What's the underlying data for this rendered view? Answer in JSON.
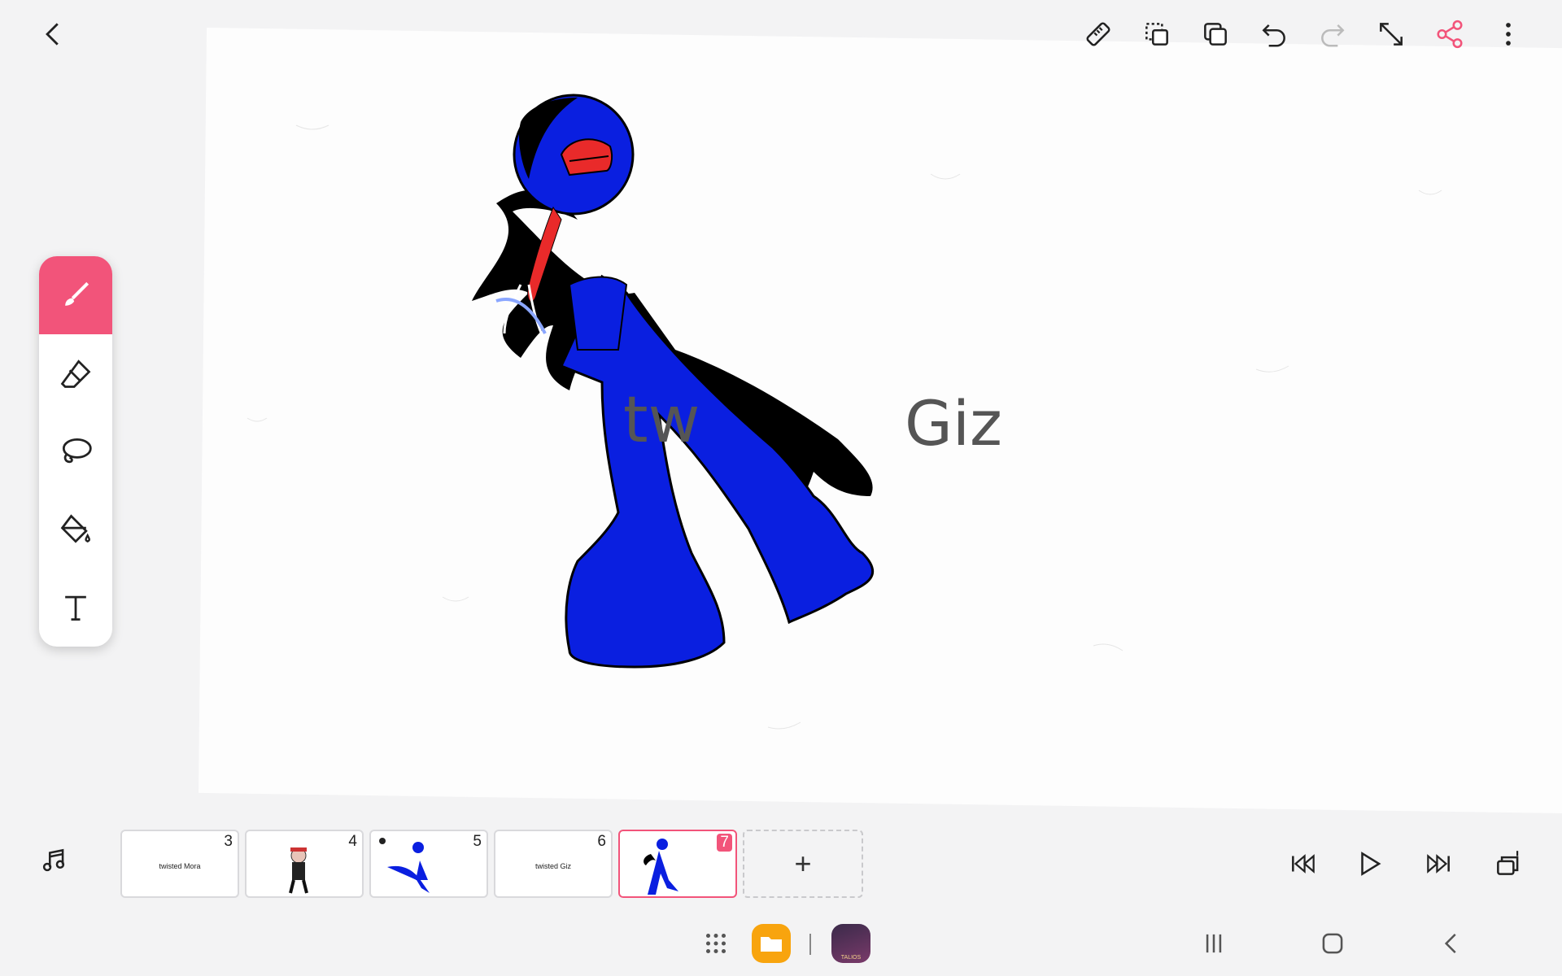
{
  "toolbar": {
    "back": "back-icon",
    "actions": [
      "ruler-icon",
      "duplicate-frame-icon",
      "copy-icon",
      "undo-icon",
      "redo-icon",
      "resize-icon",
      "share-icon",
      "more-icon"
    ],
    "accent_color": "#f2547a"
  },
  "canvas": {
    "watermark_left": "tw",
    "watermark_right": "Giz"
  },
  "tools": [
    {
      "name": "brush",
      "icon": "brush-icon",
      "active": true
    },
    {
      "name": "eraser",
      "icon": "eraser-icon",
      "active": false
    },
    {
      "name": "lasso",
      "icon": "lasso-icon",
      "active": false
    },
    {
      "name": "fill",
      "icon": "paint-bucket-icon",
      "active": false
    },
    {
      "name": "text",
      "icon": "text-icon",
      "active": false
    }
  ],
  "timeline": {
    "music_icon": "music-icon",
    "frames": [
      {
        "number": "3",
        "caption": "twisted Mora"
      },
      {
        "number": "4",
        "caption": ""
      },
      {
        "number": "5",
        "caption": ""
      },
      {
        "number": "6",
        "caption": "twisted Giz"
      },
      {
        "number": "7",
        "caption": ""
      }
    ],
    "selected_frame": "7",
    "add_label": "+",
    "playback": [
      "skip-to-start-icon",
      "play-icon",
      "skip-to-end-icon",
      "onion-skin-icon"
    ]
  },
  "system_nav": {
    "apps": [
      "app-drawer-icon",
      "my-files-icon",
      "game-app-icon"
    ],
    "game_app_label": "TALIOS",
    "buttons": [
      "recents-icon",
      "home-icon",
      "back-nav-icon"
    ]
  }
}
